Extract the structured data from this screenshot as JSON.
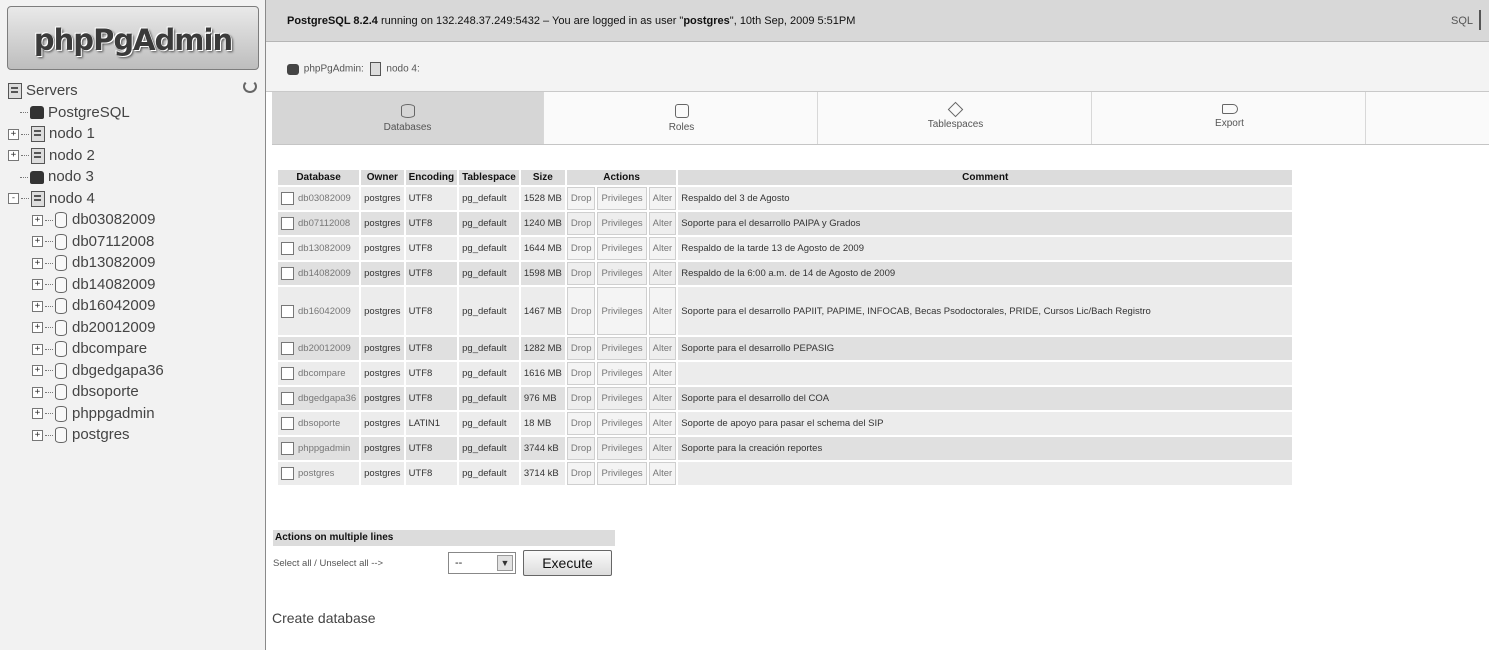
{
  "app": {
    "logo": "phpPgAdmin"
  },
  "tree": [
    {
      "label": "Servers",
      "icon": "servers-icon",
      "level": 0,
      "expander": ""
    },
    {
      "label": "PostgreSQL",
      "icon": "elephant-icon",
      "level": 1,
      "expander": ""
    },
    {
      "label": "nodo 1",
      "icon": "server-icon",
      "level": 0,
      "expander": "+"
    },
    {
      "label": "nodo 2",
      "icon": "server-icon",
      "level": 0,
      "expander": "+"
    },
    {
      "label": "nodo 3",
      "icon": "elephant-icon",
      "level": 1,
      "expander": ""
    },
    {
      "label": "nodo 4",
      "icon": "server-icon",
      "level": 0,
      "expander": "-"
    },
    {
      "label": "db03082009",
      "icon": "database-icon",
      "level": 2,
      "expander": "+"
    },
    {
      "label": "db07112008",
      "icon": "database-icon",
      "level": 2,
      "expander": "+"
    },
    {
      "label": "db13082009",
      "icon": "database-icon",
      "level": 2,
      "expander": "+"
    },
    {
      "label": "db14082009",
      "icon": "database-icon",
      "level": 2,
      "expander": "+"
    },
    {
      "label": "db16042009",
      "icon": "database-icon",
      "level": 2,
      "expander": "+"
    },
    {
      "label": "db20012009",
      "icon": "database-icon",
      "level": 2,
      "expander": "+"
    },
    {
      "label": "dbcompare",
      "icon": "database-icon",
      "level": 2,
      "expander": "+"
    },
    {
      "label": "dbgedgapa36",
      "icon": "database-icon",
      "level": 2,
      "expander": "+"
    },
    {
      "label": "dbsoporte",
      "icon": "database-icon",
      "level": 2,
      "expander": "+"
    },
    {
      "label": "phppgadmin",
      "icon": "database-icon",
      "level": 2,
      "expander": "+"
    },
    {
      "label": "postgres",
      "icon": "database-icon",
      "level": 2,
      "expander": "+"
    }
  ],
  "topbar": {
    "status_pre": "PostgreSQL 8.2.4",
    "status_mid": " running on 132.248.37.249:5432 – You are logged in as user \"",
    "user": "postgres",
    "status_post": "\", 10th Sep, 2009 5:51PM",
    "sql_link": "SQL"
  },
  "breadcrumb": {
    "app": "phpPgAdmin:",
    "node": "nodo 4",
    "suffix": ":"
  },
  "tabs": [
    {
      "label": "Databases",
      "icon": "databases-icon",
      "active": true
    },
    {
      "label": "Roles",
      "icon": "roles-icon",
      "active": false
    },
    {
      "label": "Tablespaces",
      "icon": "tablespaces-icon",
      "active": false
    },
    {
      "label": "Export",
      "icon": "export-icon",
      "active": false
    }
  ],
  "table": {
    "headers": [
      "Database",
      "Owner",
      "Encoding",
      "Tablespace",
      "Size",
      "Actions",
      "Comment"
    ],
    "actions": [
      "Drop",
      "Privileges",
      "Alter"
    ],
    "rows": [
      [
        "db03082009",
        "postgres",
        "UTF8",
        "pg_default",
        "1528 MB",
        "Respaldo del 3 de Agosto"
      ],
      [
        "db07112008",
        "postgres",
        "UTF8",
        "pg_default",
        "1240 MB",
        "Soporte para el desarrollo PAIPA y Grados"
      ],
      [
        "db13082009",
        "postgres",
        "UTF8",
        "pg_default",
        "1644 MB",
        "Respaldo de la tarde 13 de Agosto de 2009"
      ],
      [
        "db14082009",
        "postgres",
        "UTF8",
        "pg_default",
        "1598 MB",
        "Respaldo de la 6:00 a.m. de 14 de Agosto de 2009"
      ],
      [
        "db16042009",
        "postgres",
        "UTF8",
        "pg_default",
        "1467 MB",
        "Soporte para el desarrollo PAPIIT, PAPIME, INFOCAB, Becas Psodoctorales, PRIDE, Cursos Lic/Bach Registro"
      ],
      [
        "db20012009",
        "postgres",
        "UTF8",
        "pg_default",
        "1282 MB",
        "Soporte para el desarrollo PEPASIG"
      ],
      [
        "dbcompare",
        "postgres",
        "UTF8",
        "pg_default",
        "1616 MB",
        ""
      ],
      [
        "dbgedgapa36",
        "postgres",
        "UTF8",
        "pg_default",
        "976 MB",
        "Soporte para el desarrollo del COA"
      ],
      [
        "dbsoporte",
        "postgres",
        "LATIN1",
        "pg_default",
        "18 MB",
        "Soporte de apoyo para pasar el schema del SIP"
      ],
      [
        "phppgadmin",
        "postgres",
        "UTF8",
        "pg_default",
        "3744 kB",
        "Soporte para la creación reportes"
      ],
      [
        "postgres",
        "postgres",
        "UTF8",
        "pg_default",
        "3714 kB",
        ""
      ]
    ]
  },
  "multi": {
    "title": "Actions on multiple lines",
    "select_text": "Select all / Unselect all",
    "arrow": "-->",
    "select_value": "--",
    "execute": "Execute"
  },
  "create_db": "Create database"
}
